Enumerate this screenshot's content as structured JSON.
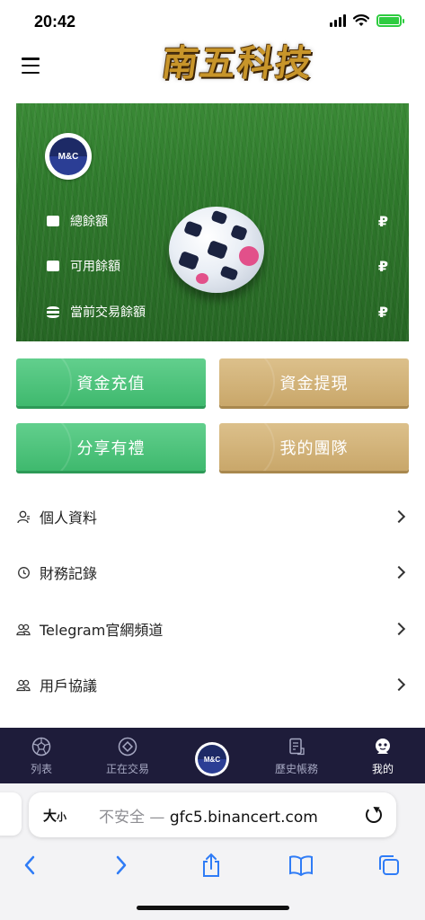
{
  "status": {
    "time": "20:42"
  },
  "header": {
    "logo_text": "南五科技"
  },
  "hero": {
    "badge_text": "M&C",
    "balances": [
      {
        "label": "總餘額",
        "currency": "₽",
        "icon": "wallet-icon"
      },
      {
        "label": "可用餘額",
        "currency": "₽",
        "icon": "card-icon"
      },
      {
        "label": "當前交易餘額",
        "currency": "₽",
        "icon": "coin-stack-icon"
      }
    ]
  },
  "actions": {
    "deposit": "資金充值",
    "withdraw": "資金提現",
    "share": "分享有禮",
    "team": "我的團隊"
  },
  "menu": {
    "items": [
      {
        "label": "個人資料",
        "icon": "user-icon"
      },
      {
        "label": "財務記錄",
        "icon": "history-icon"
      },
      {
        "label": "Telegram官網頻道",
        "icon": "group-icon"
      },
      {
        "label": "用戶協議",
        "icon": "group-icon"
      }
    ]
  },
  "tabbar": {
    "list": "列表",
    "trading": "正在交易",
    "center_badge": "M&C",
    "history": "歷史帳務",
    "mine": "我的",
    "active_color": "#ffffff",
    "bg_color": "#1e1c3a"
  },
  "browser": {
    "aa_big": "大",
    "aa_small": "小",
    "insecure": "不安全 — ",
    "domain": "gfc5.binancert.com"
  },
  "colors": {
    "green_button": "#3fb96e",
    "gold_button": "#c9a76a"
  }
}
